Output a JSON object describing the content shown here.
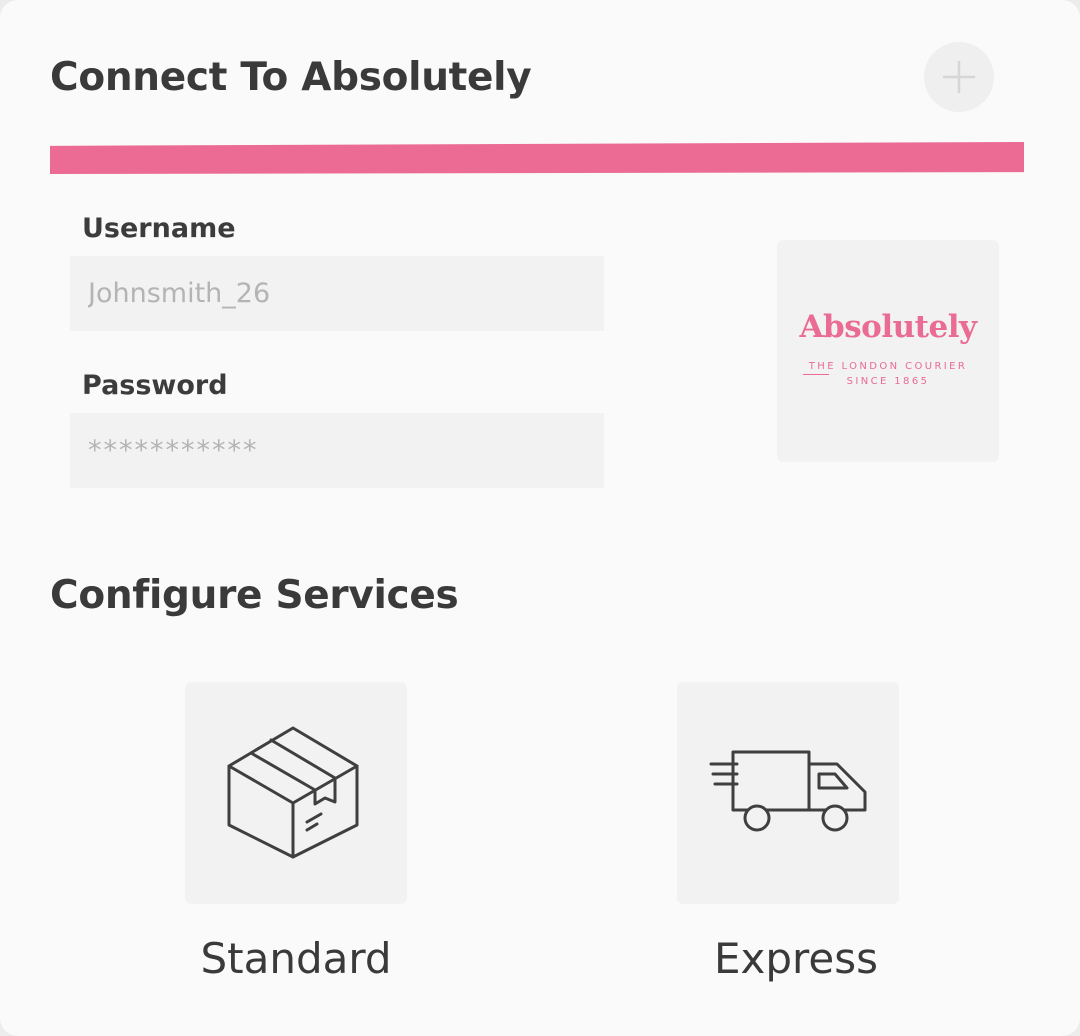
{
  "connect": {
    "title": "Connect To Absolutely",
    "accent_color": "#eb6b94",
    "add_button_icon": "plus-icon"
  },
  "credentials": {
    "username_label": "Username",
    "username_value": "Johnsmith_26",
    "password_label": "Password",
    "password_value": "***********"
  },
  "brand_logo": {
    "name": "Absolutely",
    "tagline_line1": "THE LONDON COURIER",
    "tagline_line2": "SINCE 1865",
    "color": "#ea6b93"
  },
  "services": {
    "title": "Configure Services",
    "items": [
      {
        "label": "Standard",
        "icon": "package-box-icon"
      },
      {
        "label": "Express",
        "icon": "delivery-truck-icon"
      }
    ]
  }
}
